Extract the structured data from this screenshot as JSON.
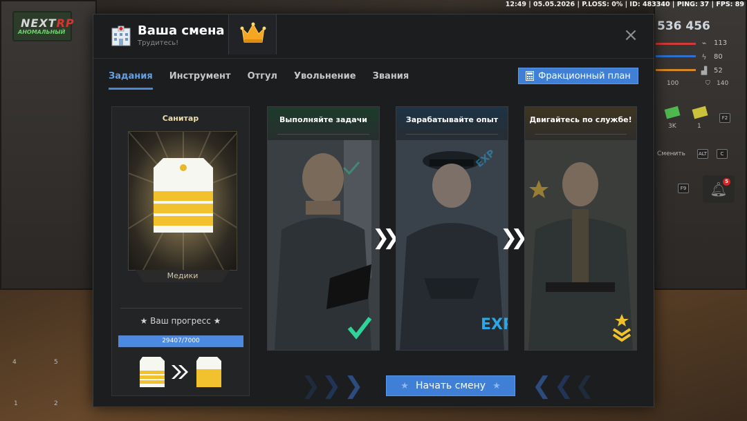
{
  "hud": {
    "status_line": "12:49 | 05.05.2026 | P.LOSS: 0% | ID: 483340 | PING: 37 | FPS: 89",
    "money": "536 456",
    "stats": [
      {
        "icon": "heartbeat-icon",
        "value": "113"
      },
      {
        "icon": "lightning-icon",
        "value": "80"
      },
      {
        "icon": "food-icon",
        "value": "52"
      }
    ],
    "armor_left": "100",
    "armor_right": "140",
    "item_counts": [
      "3K",
      "1"
    ],
    "switch_label": "Сменить",
    "keys": [
      "F2",
      "ALT",
      "C",
      "F9"
    ],
    "bell_badge": "5",
    "slots": [
      "4",
      "5",
      "1",
      "2"
    ],
    "logo_text_main": "NEXT",
    "logo_text_accent": "RP",
    "logo_sub": "АНОМАЛЬНЫЙ"
  },
  "modal": {
    "title": "Ваша смена",
    "subtitle": "Трудитесь!",
    "tabs": [
      "Задания",
      "Инструмент",
      "Отгул",
      "Увольнение",
      "Звания"
    ],
    "active_tab": 0,
    "faction_plan_label": "Фракционный план",
    "rank": {
      "name": "Санитар",
      "department": "Медики",
      "progress_label": "★ Ваш прогресс ★",
      "progress_text": "29407/7000",
      "progress_fraction": 1.0
    },
    "steps": [
      {
        "title": "Выполняйте задачи",
        "badge": "check-icon"
      },
      {
        "title": "Зарабатывайте опыт",
        "badge": "EXP"
      },
      {
        "title": "Двигайтесь по службе!",
        "badge": "rank-chevron-icon"
      }
    ],
    "start_button_label": "Начать смену"
  },
  "colors": {
    "accent": "#3f7fd6",
    "tab_active": "#64a0e6",
    "rank_gold": "#f2c12e",
    "check_green": "#2fd39a",
    "exp_blue": "#2aa7e8"
  }
}
